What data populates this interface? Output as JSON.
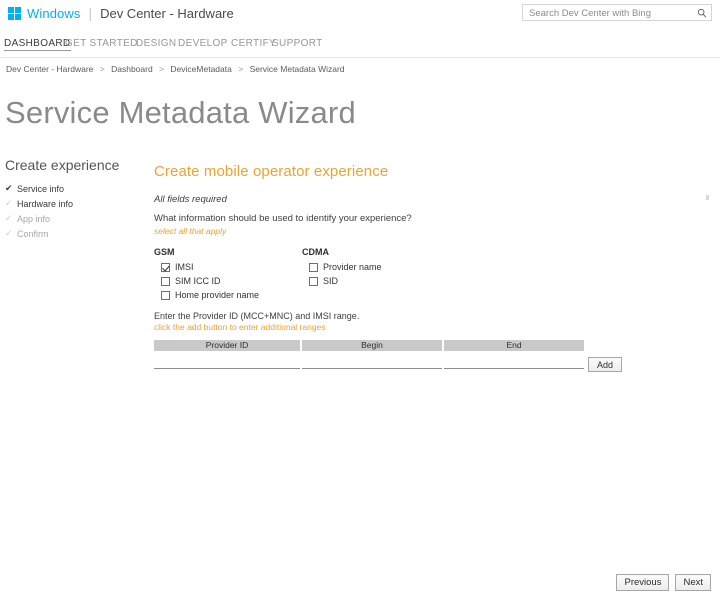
{
  "header": {
    "logo_icon": "windows-logo-icon",
    "brand": "Windows",
    "separator": "|",
    "subtitle": "Dev Center - Hardware",
    "search": {
      "placeholder": "Search Dev Center with Bing",
      "value": "",
      "icon": "search-icon"
    }
  },
  "nav": {
    "items": [
      {
        "label": "DASHBOARD",
        "active": true
      },
      {
        "label": "GET STARTED",
        "active": false
      },
      {
        "label": "DESIGN",
        "active": false
      },
      {
        "label": "DEVELOP",
        "active": false
      },
      {
        "label": "CERTIFY",
        "active": false
      },
      {
        "label": "SUPPORT",
        "active": false
      }
    ]
  },
  "breadcrumb": {
    "separator": ">",
    "items": [
      "Dev Center - Hardware",
      "Dashboard",
      "DeviceMetadata",
      "Service Metadata Wizard"
    ]
  },
  "page_title": "Service Metadata Wizard",
  "sidebar": {
    "title": "Create experience",
    "steps": [
      {
        "label": "Service info",
        "tick": "✔",
        "state": "done"
      },
      {
        "label": "Hardware info",
        "tick": "✓",
        "state": "todo-dark"
      },
      {
        "label": "App info",
        "tick": "✓",
        "state": "todo"
      },
      {
        "label": "Confirm",
        "tick": "✓",
        "state": "todo"
      }
    ]
  },
  "main": {
    "heading": "Create mobile operator experience",
    "all_fields_required": "All fields required",
    "question": "What information should be used to identify your experience?",
    "select_hint": "select all that apply",
    "groups": [
      {
        "title": "GSM",
        "options": [
          {
            "label": "IMSI",
            "checked": true
          },
          {
            "label": "SIM ICC ID",
            "checked": false
          },
          {
            "label": "Home provider name",
            "checked": false
          }
        ]
      },
      {
        "title": "CDMA",
        "options": [
          {
            "label": "Provider name",
            "checked": false
          },
          {
            "label": "SID",
            "checked": false
          }
        ]
      }
    ],
    "range_info": "Enter the Provider ID (MCC+MNC) and IMSI range.",
    "range_hint": "click the add button to enter additional ranges",
    "table": {
      "columns": [
        "Provider ID",
        "Begin",
        "End"
      ],
      "rows": [
        {
          "provider_id": "",
          "begin": "",
          "end": ""
        }
      ],
      "add_label": "Add"
    }
  },
  "footer": {
    "previous_label": "Previous",
    "next_label": "Next"
  },
  "colors": {
    "brand_blue": "#00b0f0",
    "accent_orange": "#f0a22e",
    "table_header_gray": "#c9c9c9",
    "title_gray": "#8a8a8a"
  }
}
